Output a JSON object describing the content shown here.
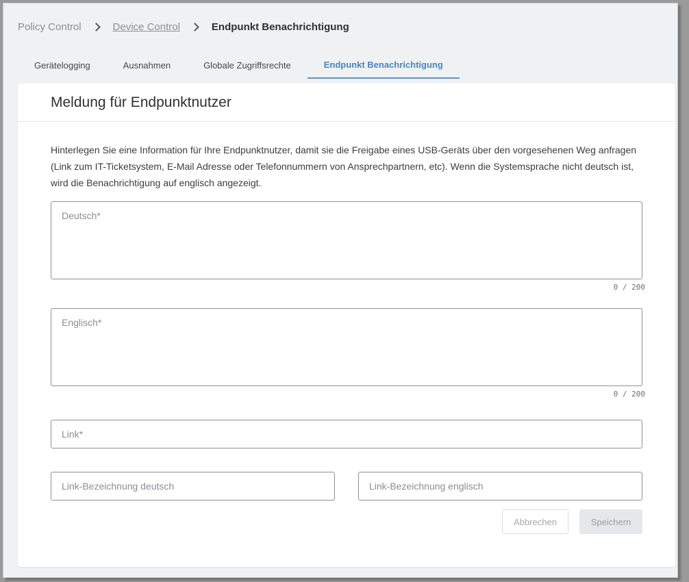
{
  "breadcrumb": {
    "root": "Policy Control",
    "parent": "Device Control",
    "current": "Endpunkt Benachrichtigung"
  },
  "tabs": [
    {
      "label": "Gerätelogging",
      "active": false
    },
    {
      "label": "Ausnahmen",
      "active": false
    },
    {
      "label": "Globale Zugriffsrechte",
      "active": false
    },
    {
      "label": "Endpunkt Benachrichtigung",
      "active": true
    }
  ],
  "card": {
    "title": "Meldung für Endpunktnutzer",
    "description": "Hinterlegen Sie eine Information für Ihre Endpunktnutzer, damit sie die Freigabe eines USB-Geräts über den vorgesehenen Weg anfragen (Link zum IT-Ticketsystem, E-Mail Adresse oder Telefonnummern von Ansprechpartnern, etc). Wenn die Systemsprache nicht deutsch ist, wird die Benachrichtigung auf englisch angezeigt."
  },
  "form": {
    "deutsch": {
      "placeholder": "Deutsch*",
      "value": "",
      "counter": "0 / 200"
    },
    "englisch": {
      "placeholder": "Englisch*",
      "value": "",
      "counter": "0 / 200"
    },
    "link": {
      "placeholder": "Link*",
      "value": ""
    },
    "link_label_de": {
      "placeholder": "Link-Bezeichnung deutsch",
      "value": ""
    },
    "link_label_en": {
      "placeholder": "Link-Bezeichnung englisch",
      "value": ""
    }
  },
  "buttons": {
    "cancel": "Abbrechen",
    "save": "Speichern"
  },
  "colors": {
    "accent": "#4a86b8",
    "border": "#8d9095"
  }
}
